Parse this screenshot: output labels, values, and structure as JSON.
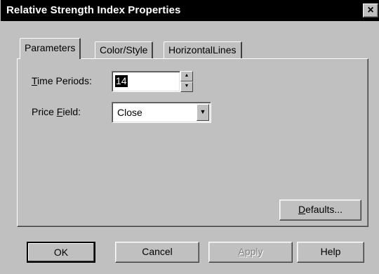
{
  "dialog": {
    "title": "Relative Strength Index Properties",
    "close_glyph": "×"
  },
  "tabs": [
    {
      "label": "Parameters",
      "active": true
    },
    {
      "label": "Color/Style",
      "active": false
    },
    {
      "label": "HorizontalLines",
      "active": false
    }
  ],
  "parameters": {
    "time_periods": {
      "label_mnemonic": "T",
      "label_rest": "ime Periods:",
      "value": "14"
    },
    "price_field": {
      "label_start": "Price ",
      "label_mnemonic": "F",
      "label_rest": "ield:",
      "value": "Close"
    },
    "defaults_button": {
      "mnemonic": "D",
      "rest": "efaults..."
    }
  },
  "buttons": {
    "ok": "OK",
    "cancel": "Cancel",
    "apply_mnemonic": "A",
    "apply_rest": "pply",
    "help": "Help"
  },
  "icons": {
    "spin_up": "▲",
    "spin_down": "▼",
    "dropdown": "▼"
  },
  "colors": {
    "titlebar": "#000000",
    "face": "#c0c0c0"
  }
}
